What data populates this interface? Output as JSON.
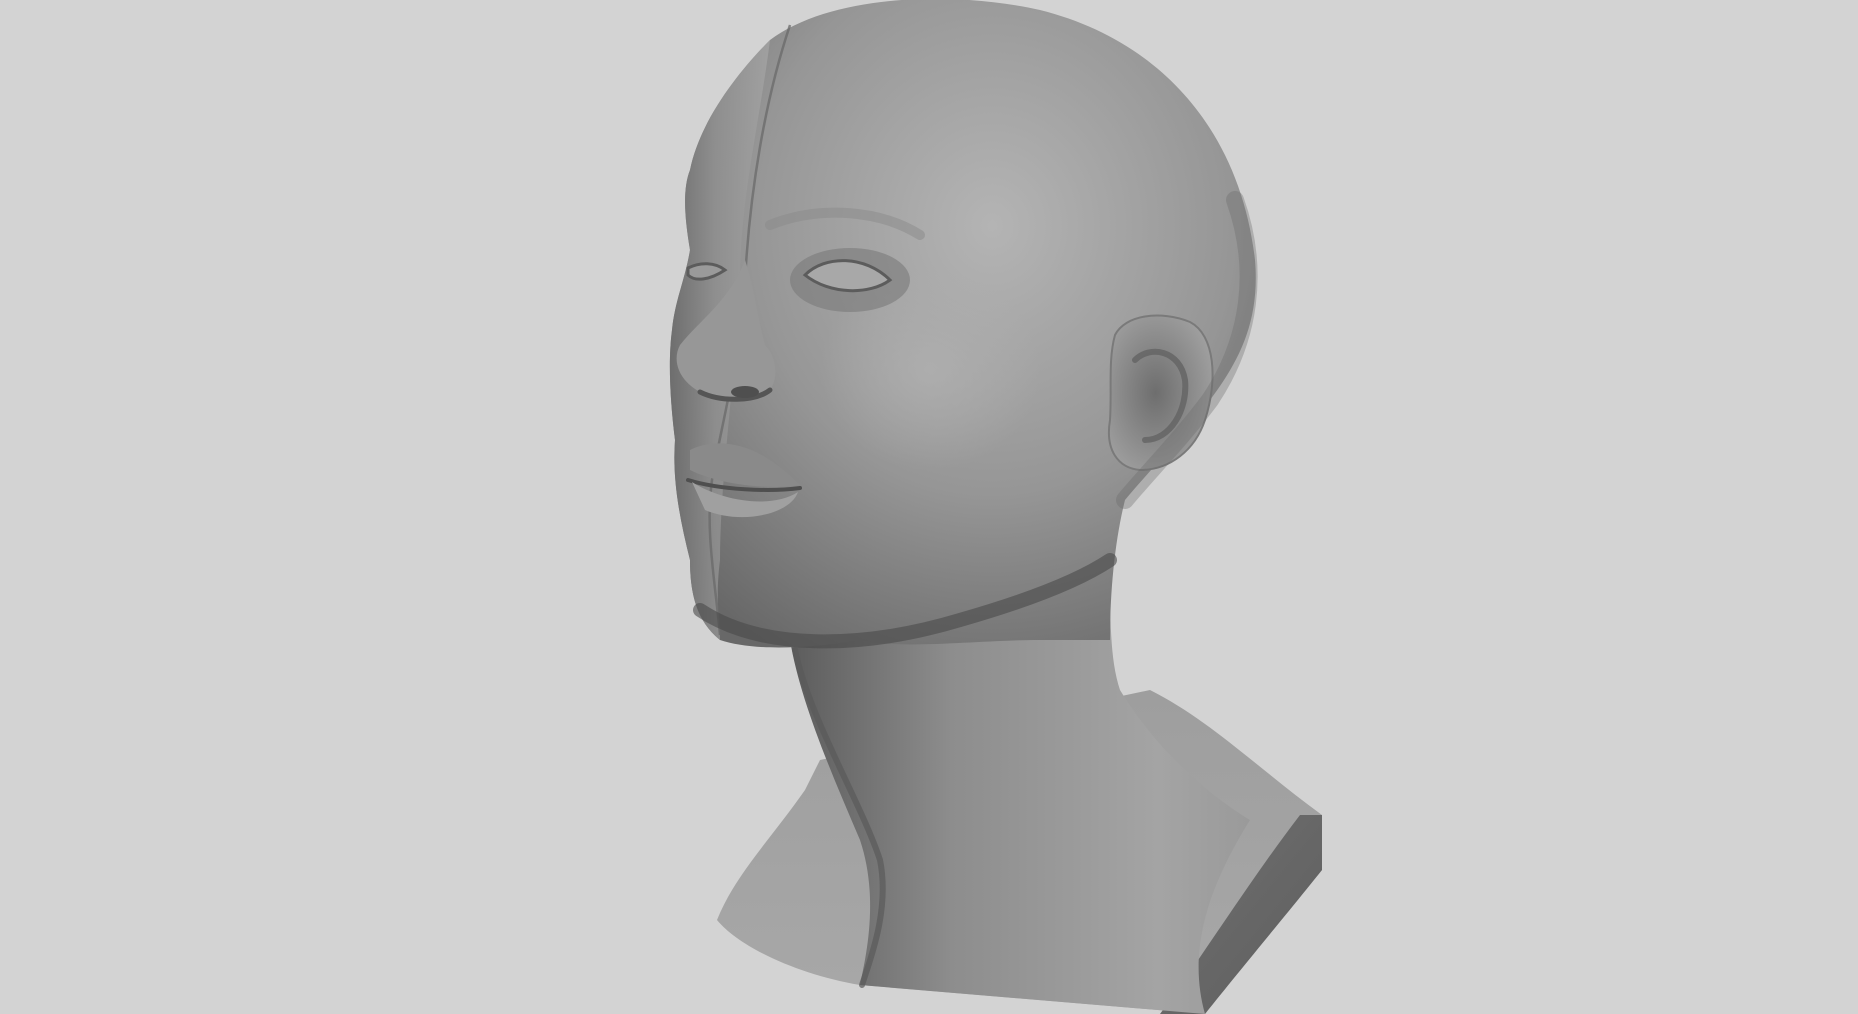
{
  "scene": {
    "subject": "bust-sculpt",
    "colors": {
      "background": "#d3d3d3",
      "surface_light": "#a9a9a9",
      "surface_mid": "#8a8a8a",
      "surface_dark": "#5a5a5a",
      "cut_plane": "#6a6a6a"
    }
  }
}
